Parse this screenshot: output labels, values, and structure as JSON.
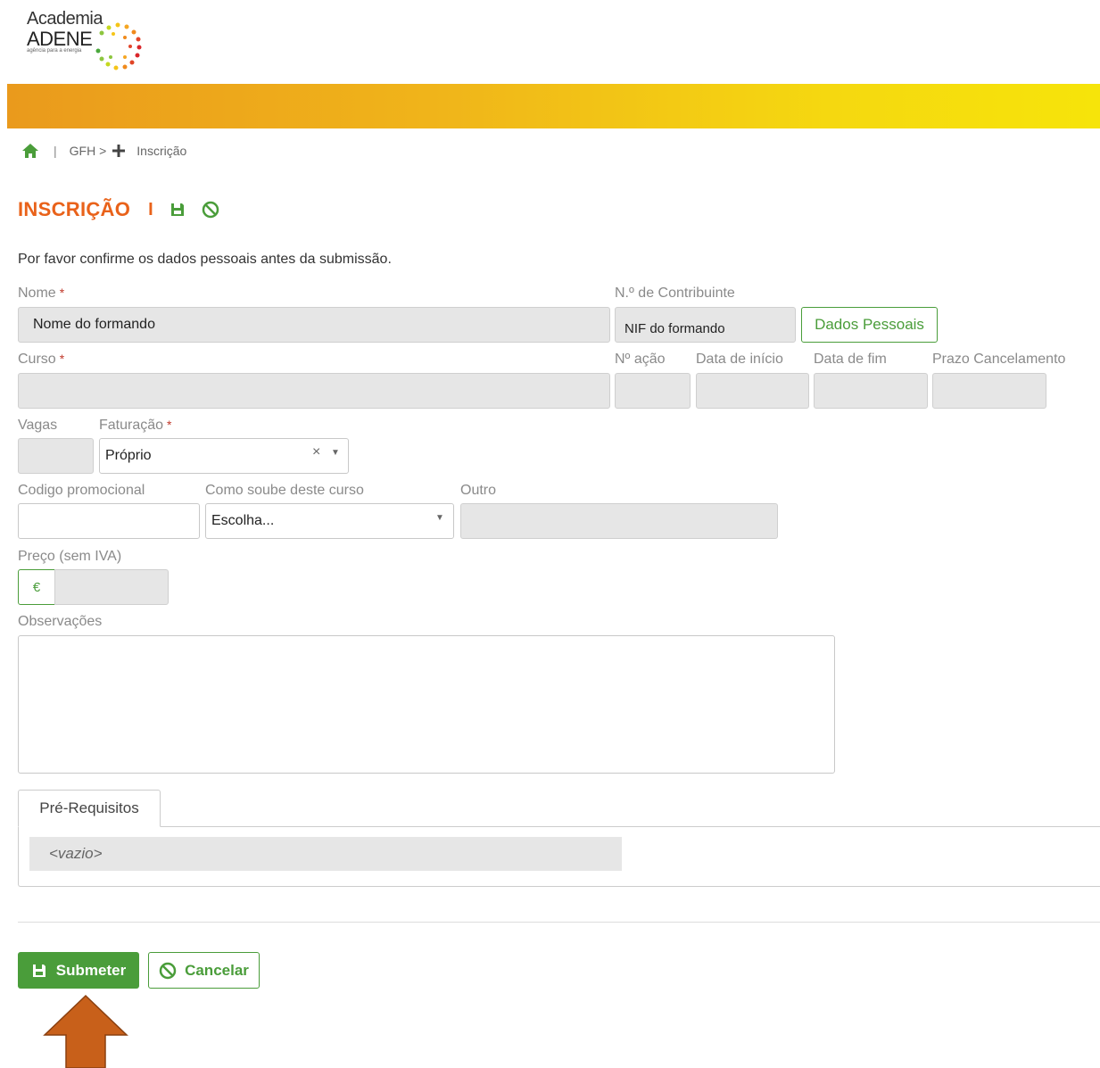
{
  "logo": {
    "line1": "Academia",
    "line2": "ADENE",
    "tagline": "agência para a energia"
  },
  "breadcrumb": {
    "separator": "|",
    "parent": "GFH >",
    "current": "Inscrição"
  },
  "page": {
    "title": "INSCRIÇÃO",
    "title_separator": "I"
  },
  "intro": "Por favor confirme os dados pessoais antes da submissão.",
  "form": {
    "nome": {
      "label": "Nome",
      "required_mark": "*",
      "value": "Nome do formando"
    },
    "nif": {
      "label": "N.º de Contribuinte",
      "value": "NIF do formando"
    },
    "dados_pessoais_button": "Dados Pessoais",
    "curso": {
      "label": "Curso",
      "required_mark": "*",
      "value": ""
    },
    "n_acao": {
      "label": "Nº ação",
      "value": ""
    },
    "data_inicio": {
      "label": "Data de início",
      "value": ""
    },
    "data_fim": {
      "label": "Data de fim",
      "value": ""
    },
    "prazo_cancelamento": {
      "label": "Prazo Cancelamento",
      "value": ""
    },
    "vagas": {
      "label": "Vagas",
      "value": ""
    },
    "faturacao": {
      "label": "Faturação",
      "required_mark": "*",
      "value": "Próprio",
      "clear_glyph": "×",
      "caret_glyph": "▼"
    },
    "codigo_promocional": {
      "label": "Codigo promocional",
      "value": ""
    },
    "como_soube": {
      "label": "Como soube deste curso",
      "value": "Escolha...",
      "caret_glyph": "▼"
    },
    "outro": {
      "label": "Outro",
      "value": ""
    },
    "preco": {
      "label": "Preço (sem IVA)",
      "currency": "€",
      "value": ""
    },
    "observacoes": {
      "label": "Observações",
      "value": ""
    }
  },
  "prerequisites": {
    "tab_label": "Pré-Requisitos",
    "empty_text": "<vazio>"
  },
  "actions": {
    "submit": "Submeter",
    "cancel": "Cancelar"
  },
  "colors": {
    "accent_orange": "#e9621a",
    "green": "#4a9d3a",
    "arrow": "#c8601a"
  }
}
